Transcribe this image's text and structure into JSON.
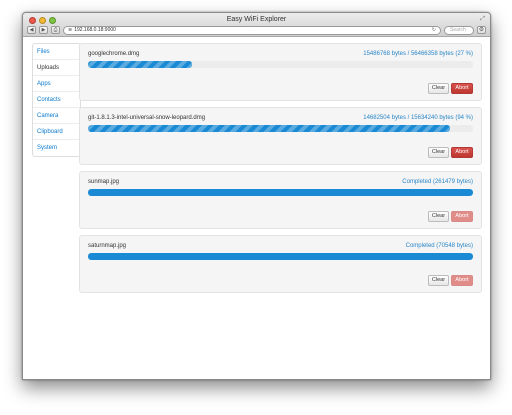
{
  "window": {
    "title": "Easy WiFi Explorer",
    "url": "192.168.0.18:9000",
    "search_placeholder": "Search"
  },
  "sidebar": {
    "items": [
      {
        "label": "Files",
        "active": false
      },
      {
        "label": "Uploads",
        "active": true
      },
      {
        "label": "Apps",
        "active": false
      },
      {
        "label": "Contacts",
        "active": false
      },
      {
        "label": "Camera",
        "active": false
      },
      {
        "label": "Clipboard",
        "active": false
      },
      {
        "label": "System",
        "active": false
      }
    ]
  },
  "uploads": [
    {
      "name": "googlechrome.dmg",
      "status": "15486768 bytes / 56466358 bytes (27 %)",
      "progress": 0.27,
      "in_progress": true,
      "clear_label": "Clear",
      "abort_label": "Abort"
    },
    {
      "name": "git-1.8.1.3-intel-universal-snow-leopard.dmg",
      "status": "14682504 bytes / 15634240 bytes (94 %)",
      "progress": 0.94,
      "in_progress": true,
      "clear_label": "Clear",
      "abort_label": "Abort"
    },
    {
      "name": "sunmap.jpg",
      "status": "Completed (261479 bytes)",
      "progress": 1.0,
      "in_progress": false,
      "clear_label": "Clear",
      "abort_label": "Abort"
    },
    {
      "name": "saturnmap.jpg",
      "status": "Completed (70548 bytes)",
      "progress": 1.0,
      "in_progress": false,
      "clear_label": "Clear",
      "abort_label": "Abort"
    }
  ],
  "colors": {
    "accent": "#1a8ad4",
    "abort": "#d9534f",
    "link": "#0a7ad1"
  }
}
